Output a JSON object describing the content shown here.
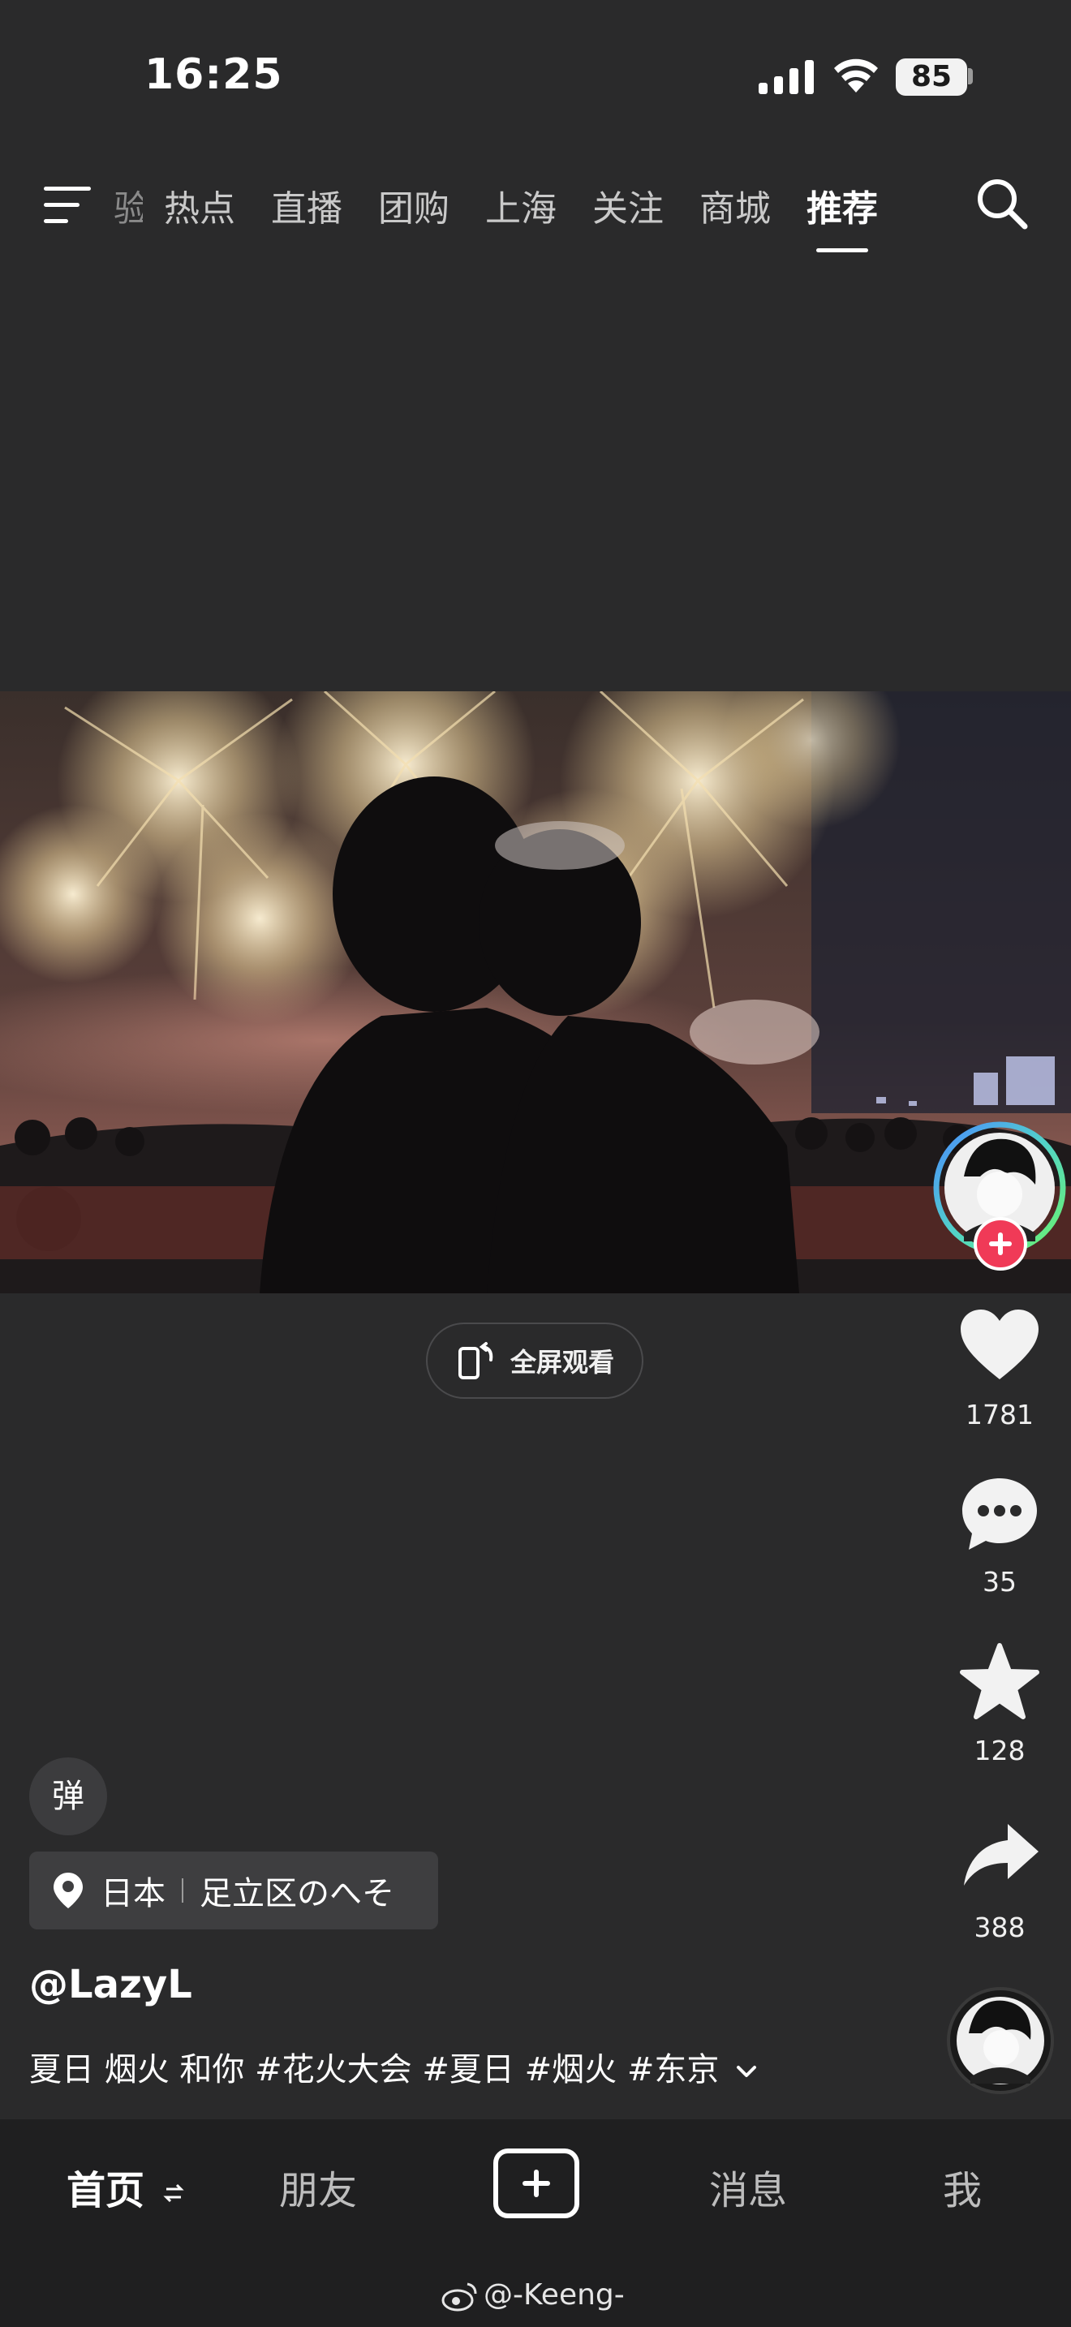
{
  "status_bar": {
    "time": "16:25",
    "battery": "85"
  },
  "top_nav": {
    "tabs": [
      {
        "label": "验",
        "state": "partial"
      },
      {
        "label": "热点"
      },
      {
        "label": "直播"
      },
      {
        "label": "团购"
      },
      {
        "label": "上海"
      },
      {
        "label": "关注"
      },
      {
        "label": "商城"
      },
      {
        "label": "推荐",
        "state": "active"
      }
    ]
  },
  "player": {
    "fullscreen_label": "全屏观看"
  },
  "actions": {
    "like_count": "1781",
    "comment_count": "35",
    "favorite_count": "128",
    "share_count": "388"
  },
  "post": {
    "danmu_label": "弹",
    "location_country": "日本",
    "location_place": "足立区のへそ",
    "author": "@LazyL",
    "caption": "夏日 烟火 和你 #花火大会 #夏日 #烟火 #东京"
  },
  "bottom_nav": {
    "home": "首页",
    "friends": "朋友",
    "messages": "消息",
    "me": "我"
  },
  "watermark": "@-Keeng-",
  "colors": {
    "background": "#2a2a2b",
    "follow_badge": "#f03a57",
    "nav_bg": "#1f1f20"
  }
}
